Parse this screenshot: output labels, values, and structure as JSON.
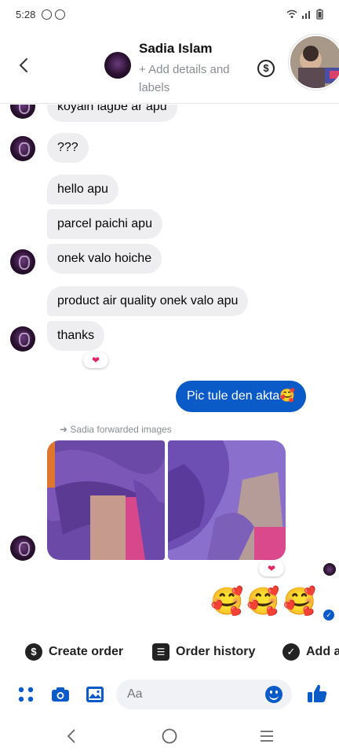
{
  "status_bar": {
    "time": "5:28"
  },
  "header": {
    "contact_name": "Sadia Islam",
    "subtitle": "+ Add details and labels",
    "dollar_icon": "dollar-icon"
  },
  "messages": {
    "partial_text": "koyain lagbe ar apu",
    "m1": "???",
    "m2": "hello apu",
    "m3": "parcel paichi apu",
    "m4": "onek valo hoiche",
    "m5": "product air quality onek valo apu",
    "m6": "thanks",
    "outgoing": "Pic tule den akta🥰",
    "forward_note": "Sadia forwarded images",
    "emoji_reply": "🥰🥰🥰"
  },
  "actions": {
    "create_order": "Create order",
    "order_history": "Order history",
    "add_label": "Add a"
  },
  "composer": {
    "placeholder": "Aa"
  },
  "colors": {
    "accent": "#0a5ac8",
    "bubble": "#eeeef0",
    "reaction": "#e0245e"
  }
}
